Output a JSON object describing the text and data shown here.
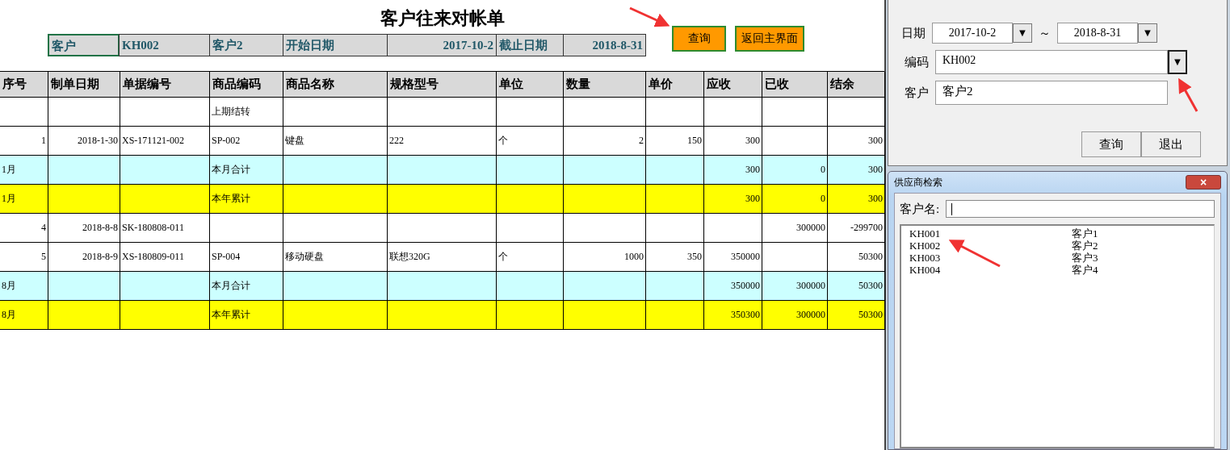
{
  "sheet": {
    "title": "客户往来对帐单",
    "info": [
      {
        "text": "客户",
        "selected": true
      },
      {
        "text": "KH002",
        "selected": false
      },
      {
        "text": "客户2",
        "selected": false
      },
      {
        "text": "开始日期",
        "selected": false
      },
      {
        "text": "2017-10-2",
        "selected": false
      },
      {
        "text": "截止日期",
        "selected": false
      },
      {
        "text": "2018-8-31",
        "selected": false
      }
    ],
    "buttons": [
      "查询",
      "返回主界面"
    ],
    "columns": [
      "序号",
      "制单日期",
      "单据编号",
      "商品编码",
      "商品名称",
      "规格型号",
      "单位",
      "数量",
      "单价",
      "应收",
      "已收",
      "结余"
    ],
    "rows": [
      {
        "kind": "detail",
        "cells": [
          null,
          null,
          null,
          "上期结转",
          null,
          null,
          null,
          null,
          null,
          null,
          null,
          null
        ]
      },
      {
        "kind": "detail",
        "cells": [
          "1",
          "2018-1-30",
          "XS-171121-002",
          "SP-002",
          "键盘",
          "222",
          "个",
          "2",
          "150",
          "300",
          null,
          "300"
        ]
      },
      {
        "kind": "month_total",
        "cells": [
          "1月",
          null,
          null,
          "本月合计",
          null,
          null,
          null,
          null,
          null,
          "300",
          "0",
          "300"
        ]
      },
      {
        "kind": "year_total",
        "cells": [
          "1月",
          null,
          null,
          "本年累计",
          null,
          null,
          null,
          null,
          null,
          "300",
          "0",
          "300"
        ]
      },
      {
        "kind": "detail",
        "cells": [
          "4",
          "2018-8-8",
          "SK-180808-011",
          null,
          null,
          null,
          null,
          null,
          null,
          null,
          "300000",
          "-299700"
        ]
      },
      {
        "kind": "detail",
        "cells": [
          "5",
          "2018-8-9",
          "XS-180809-011",
          "SP-004",
          "移动硬盘",
          "联想320G",
          "个",
          "1000",
          "350",
          "350000",
          null,
          "50300"
        ]
      },
      {
        "kind": "month_total",
        "cells": [
          "8月",
          null,
          null,
          "本月合计",
          null,
          null,
          null,
          null,
          null,
          "350000",
          "300000",
          "50300"
        ]
      },
      {
        "kind": "year_total",
        "cells": [
          "8月",
          null,
          null,
          "本年累计",
          null,
          null,
          null,
          null,
          null,
          "350300",
          "300000",
          "50300"
        ]
      }
    ]
  },
  "query_dialog": {
    "date_label": "日期",
    "date_from": "2017-10-2",
    "dropdown_glyph": "▼",
    "tilde": "～",
    "date_to": "2018-8-31",
    "code_label": "编码",
    "code": "KH002",
    "customer_label": "客户",
    "customer": "客户2",
    "buttons": [
      "查询",
      "退出"
    ]
  },
  "search_dialog": {
    "title": "供应商检索",
    "close": "×",
    "name_label": "客户名:",
    "items": [
      {
        "code": "KH001",
        "name": "客户1"
      },
      {
        "code": "KH002",
        "name": "客户2"
      },
      {
        "code": "KH003",
        "name": "客户3"
      },
      {
        "code": "KH004",
        "name": "客户4"
      }
    ]
  }
}
